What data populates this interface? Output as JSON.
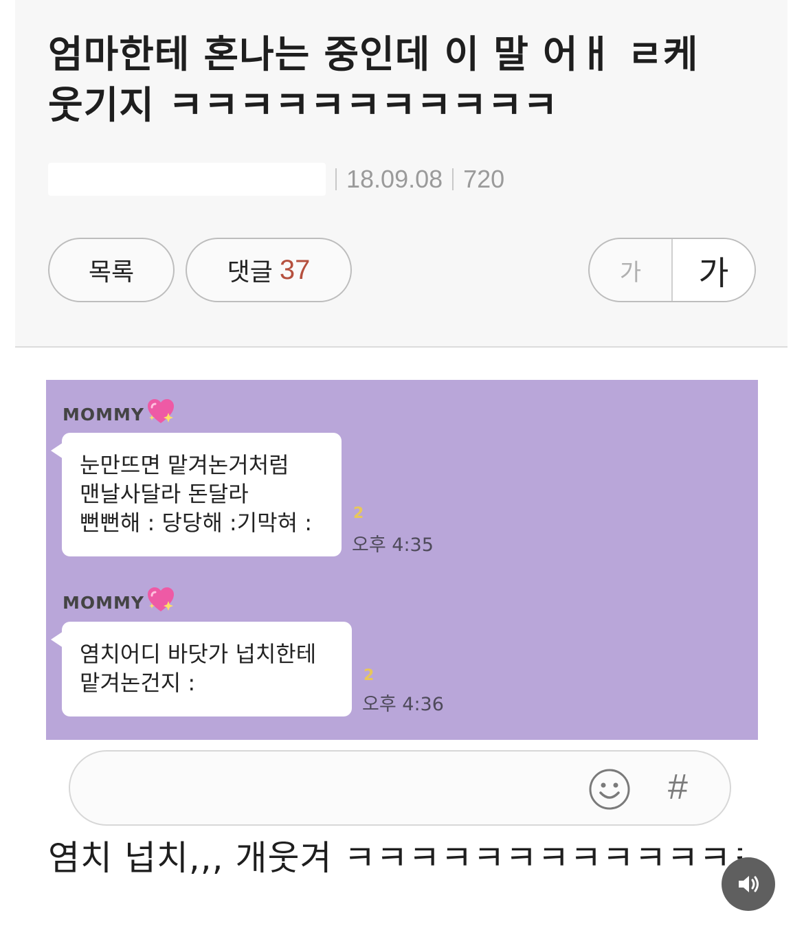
{
  "post": {
    "title_line1": "엄마한테 혼나는 중인데 이 말 어ㅐ ㄹ케",
    "title_line2": "웃기지 ㅋㅋㅋㅋㅋㅋㅋㅋㅋㅋㅋ",
    "date": "18.09.08",
    "views": "720"
  },
  "actions": {
    "list_label": "목록",
    "comment_label": "댓글",
    "comment_count": "37",
    "font_small_label": "가",
    "font_large_label": "가"
  },
  "chat": {
    "background_color": "#b9a6d9",
    "messages": [
      {
        "sender": "MOMMY",
        "lines": [
          "눈만뜨면 맡겨논거처럼",
          "맨날사달라 돈달라",
          "뻔뻔해 : 당당해 :기막혀 :"
        ],
        "unread": "2",
        "time": "오후 4:35"
      },
      {
        "sender": "MOMMY",
        "lines": [
          "염치어디 바닷가 넙치한테",
          "맡겨논건지 :"
        ],
        "unread": "2",
        "time": "오후 4:36"
      }
    ]
  },
  "input_bar": {
    "emoji_icon": "smiley-icon",
    "hash_icon": "#"
  },
  "caption": "염치 넙치,,, 개웃겨 ㅋㅋㅋㅋㅋㅋㅋㅋㅋㅋㅋㅋㅋ",
  "sound_icon": "speaker-icon"
}
